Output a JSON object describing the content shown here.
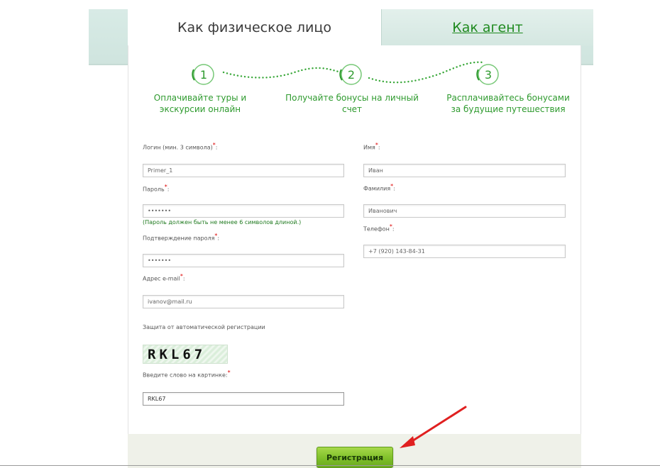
{
  "tabs": {
    "individual_label": "Как физическое лицо",
    "agent_label": "Как агент"
  },
  "steps": [
    {
      "number": "1",
      "text": "Оплачивайте туры и экскурсии онлайн"
    },
    {
      "number": "2",
      "text": "Получайте бонусы на личный счет"
    },
    {
      "number": "3",
      "text": "Расплачивайтесь бонусами за будущие путешествия"
    }
  ],
  "form": {
    "login": {
      "label": "Логин (мин. 3 символа)",
      "value": "Primer_1"
    },
    "password": {
      "label": "Пароль",
      "value": "•••••••",
      "hint": "(Пароль должен быть не менее 6 символов длиной.)"
    },
    "password_confirm": {
      "label": "Подтверждение пароля",
      "value": "•••••••"
    },
    "email": {
      "label": "Адрес e-mail",
      "value": "ivanov@mail.ru"
    },
    "captcha_heading": "Защита от автоматической регистрации",
    "captcha_image_text": "RKL67",
    "captcha_input": {
      "label": "Введите слово на картинке:",
      "value": "RKL67"
    },
    "first_name": {
      "label": "Имя",
      "value": "Иван"
    },
    "last_name": {
      "label": "Фамилия",
      "value": "Иванович"
    },
    "phone": {
      "label": "Телефон",
      "value": "+7 (920) 143-84-31"
    },
    "required_mark": "*",
    "colon": ":"
  },
  "submit_label": "Регистрация",
  "colors": {
    "accent_green": "#2e9a2e",
    "button_green": "#7fbf2a",
    "arrow_red": "#e02020"
  }
}
